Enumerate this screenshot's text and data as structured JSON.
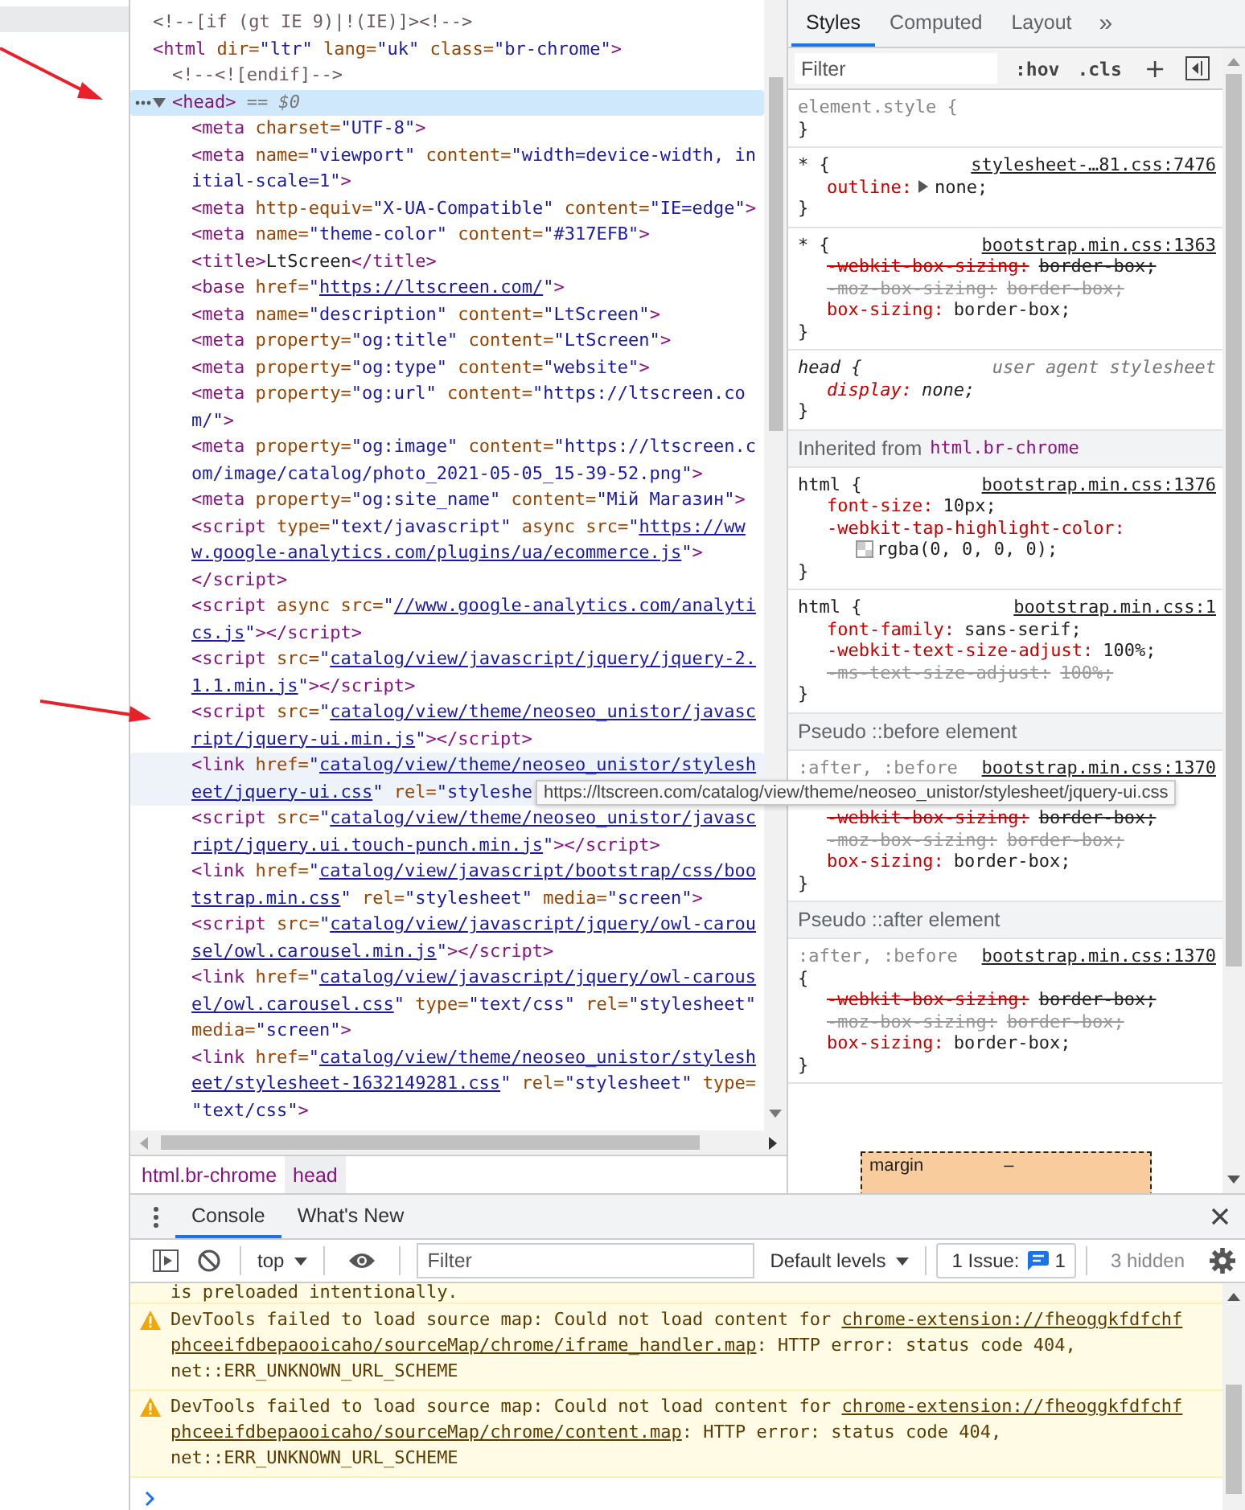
{
  "elements": {
    "nodes": [
      {
        "lines": [
          [
            {
              "kind": "comment",
              "text": "<!--[if (gt IE 9)|!(IE)]><!-->"
            }
          ]
        ],
        "selected": false,
        "hovered": false
      },
      {
        "lines": [
          [
            {
              "kind": "tag",
              "text": "<html"
            },
            {
              "kind": "attr",
              "text": " dir="
            },
            {
              "kind": "val",
              "text": "\"ltr\""
            },
            {
              "kind": "attr",
              "text": " lang="
            },
            {
              "kind": "val",
              "text": "\"uk\""
            },
            {
              "kind": "attr",
              "text": " class="
            },
            {
              "kind": "val",
              "text": "\"br-chrome\""
            },
            {
              "kind": "tag",
              "text": ">"
            }
          ]
        ],
        "selected": false,
        "hovered": false,
        "children": [
          {
            "lines": [
              [
                {
                  "kind": "comment",
                  "text": "<!--<![endif]-->"
                }
              ]
            ],
            "selected": false,
            "hovered": false
          },
          {
            "lines": [
              [
                {
                  "kind": "tag",
                  "text": "<head>"
                },
                {
                  "kind": "ref",
                  "text": " == $0"
                }
              ]
            ],
            "selected": true,
            "hovered": false,
            "expanded": true,
            "children": [
              {
                "lines": [
                  [
                    {
                      "kind": "tag",
                      "text": "<meta"
                    },
                    {
                      "kind": "attr",
                      "text": " charset="
                    },
                    {
                      "kind": "val",
                      "text": "\"UTF-8\""
                    },
                    {
                      "kind": "tag",
                      "text": ">"
                    }
                  ]
                ],
                "selected": false,
                "hovered": false
              },
              {
                "lines": [
                  [
                    {
                      "kind": "tag",
                      "text": "<meta"
                    },
                    {
                      "kind": "attr",
                      "text": " name="
                    },
                    {
                      "kind": "val",
                      "text": "\"viewport\""
                    },
                    {
                      "kind": "attr",
                      "text": " content="
                    },
                    {
                      "kind": "val",
                      "text": "\"width=device-width, in"
                    }
                  ],
                  [
                    {
                      "kind": "val",
                      "text": "itial-scale=1\""
                    },
                    {
                      "kind": "tag",
                      "text": ">"
                    }
                  ]
                ],
                "selected": false,
                "hovered": false
              },
              {
                "lines": [
                  [
                    {
                      "kind": "tag",
                      "text": "<meta"
                    },
                    {
                      "kind": "attr",
                      "text": " http-equiv="
                    },
                    {
                      "kind": "val",
                      "text": "\"X-UA-Compatible\""
                    },
                    {
                      "kind": "attr",
                      "text": " content="
                    },
                    {
                      "kind": "val",
                      "text": "\"IE=edge\""
                    },
                    {
                      "kind": "tag",
                      "text": ">"
                    }
                  ]
                ],
                "selected": false,
                "hovered": false
              },
              {
                "lines": [
                  [
                    {
                      "kind": "tag",
                      "text": "<meta"
                    },
                    {
                      "kind": "attr",
                      "text": " name="
                    },
                    {
                      "kind": "val",
                      "text": "\"theme-color\""
                    },
                    {
                      "kind": "attr",
                      "text": " content="
                    },
                    {
                      "kind": "val",
                      "text": "\"#317EFB\""
                    },
                    {
                      "kind": "tag",
                      "text": ">"
                    }
                  ]
                ],
                "selected": false,
                "hovered": false
              },
              {
                "lines": [
                  [
                    {
                      "kind": "tag",
                      "text": "<title>"
                    },
                    {
                      "kind": "text",
                      "text": "LtScreen"
                    },
                    {
                      "kind": "tag",
                      "text": "</title>"
                    }
                  ]
                ],
                "selected": false,
                "hovered": false
              },
              {
                "lines": [
                  [
                    {
                      "kind": "tag",
                      "text": "<base"
                    },
                    {
                      "kind": "attr",
                      "text": " href="
                    },
                    {
                      "kind": "val",
                      "text": "\""
                    },
                    {
                      "kind": "link",
                      "text": "https://ltscreen.com/"
                    },
                    {
                      "kind": "val",
                      "text": "\""
                    },
                    {
                      "kind": "tag",
                      "text": ">"
                    }
                  ]
                ],
                "selected": false,
                "hovered": false
              },
              {
                "lines": [
                  [
                    {
                      "kind": "tag",
                      "text": "<meta"
                    },
                    {
                      "kind": "attr",
                      "text": " name="
                    },
                    {
                      "kind": "val",
                      "text": "\"description\""
                    },
                    {
                      "kind": "attr",
                      "text": " content="
                    },
                    {
                      "kind": "val",
                      "text": "\"LtScreen\""
                    },
                    {
                      "kind": "tag",
                      "text": ">"
                    }
                  ]
                ],
                "selected": false,
                "hovered": false
              },
              {
                "lines": [
                  [
                    {
                      "kind": "tag",
                      "text": "<meta"
                    },
                    {
                      "kind": "attr",
                      "text": " property="
                    },
                    {
                      "kind": "val",
                      "text": "\"og:title\""
                    },
                    {
                      "kind": "attr",
                      "text": " content="
                    },
                    {
                      "kind": "val",
                      "text": "\"LtScreen\""
                    },
                    {
                      "kind": "tag",
                      "text": ">"
                    }
                  ]
                ],
                "selected": false,
                "hovered": false
              },
              {
                "lines": [
                  [
                    {
                      "kind": "tag",
                      "text": "<meta"
                    },
                    {
                      "kind": "attr",
                      "text": " property="
                    },
                    {
                      "kind": "val",
                      "text": "\"og:type\""
                    },
                    {
                      "kind": "attr",
                      "text": " content="
                    },
                    {
                      "kind": "val",
                      "text": "\"website\""
                    },
                    {
                      "kind": "tag",
                      "text": ">"
                    }
                  ]
                ],
                "selected": false,
                "hovered": false
              },
              {
                "lines": [
                  [
                    {
                      "kind": "tag",
                      "text": "<meta"
                    },
                    {
                      "kind": "attr",
                      "text": " property="
                    },
                    {
                      "kind": "val",
                      "text": "\"og:url\""
                    },
                    {
                      "kind": "attr",
                      "text": " content="
                    },
                    {
                      "kind": "val",
                      "text": "\"https://ltscreen.co"
                    }
                  ],
                  [
                    {
                      "kind": "val",
                      "text": "m/\""
                    },
                    {
                      "kind": "tag",
                      "text": ">"
                    }
                  ]
                ],
                "selected": false,
                "hovered": false
              },
              {
                "lines": [
                  [
                    {
                      "kind": "tag",
                      "text": "<meta"
                    },
                    {
                      "kind": "attr",
                      "text": " property="
                    },
                    {
                      "kind": "val",
                      "text": "\"og:image\""
                    },
                    {
                      "kind": "attr",
                      "text": " content="
                    },
                    {
                      "kind": "val",
                      "text": "\"https://ltscreen.c"
                    }
                  ],
                  [
                    {
                      "kind": "val",
                      "text": "om/image/catalog/photo_2021-05-05_15-39-52.png\""
                    },
                    {
                      "kind": "tag",
                      "text": ">"
                    }
                  ]
                ],
                "selected": false,
                "hovered": false
              },
              {
                "lines": [
                  [
                    {
                      "kind": "tag",
                      "text": "<meta"
                    },
                    {
                      "kind": "attr",
                      "text": " property="
                    },
                    {
                      "kind": "val",
                      "text": "\"og:site_name\""
                    },
                    {
                      "kind": "attr",
                      "text": " content="
                    },
                    {
                      "kind": "val",
                      "text": "\"Мій Магазин\""
                    },
                    {
                      "kind": "tag",
                      "text": ">"
                    }
                  ]
                ],
                "selected": false,
                "hovered": false
              },
              {
                "lines": [
                  [
                    {
                      "kind": "tag",
                      "text": "<script"
                    },
                    {
                      "kind": "attr",
                      "text": " type="
                    },
                    {
                      "kind": "val",
                      "text": "\"text/javascript\""
                    },
                    {
                      "kind": "attr",
                      "text": " async"
                    },
                    {
                      "kind": "attr",
                      "text": " src="
                    },
                    {
                      "kind": "val",
                      "text": "\""
                    },
                    {
                      "kind": "link",
                      "text": "https://ww"
                    }
                  ],
                  [
                    {
                      "kind": "link",
                      "text": "w.google-analytics.com/plugins/ua/ecommerce.js"
                    },
                    {
                      "kind": "val",
                      "text": "\""
                    },
                    {
                      "kind": "tag",
                      "text": ">"
                    }
                  ],
                  [
                    {
                      "kind": "tag",
                      "text": "</script>"
                    }
                  ]
                ],
                "selected": false,
                "hovered": false
              },
              {
                "lines": [
                  [
                    {
                      "kind": "tag",
                      "text": "<script"
                    },
                    {
                      "kind": "attr",
                      "text": " async"
                    },
                    {
                      "kind": "attr",
                      "text": " src="
                    },
                    {
                      "kind": "val",
                      "text": "\""
                    },
                    {
                      "kind": "link",
                      "text": "//www.google-analytics.com/analyti"
                    }
                  ],
                  [
                    {
                      "kind": "link",
                      "text": "cs.js"
                    },
                    {
                      "kind": "val",
                      "text": "\""
                    },
                    {
                      "kind": "tag",
                      "text": "></script>"
                    }
                  ]
                ],
                "selected": false,
                "hovered": false
              },
              {
                "lines": [
                  [
                    {
                      "kind": "tag",
                      "text": "<script"
                    },
                    {
                      "kind": "attr",
                      "text": " src="
                    },
                    {
                      "kind": "val",
                      "text": "\""
                    },
                    {
                      "kind": "link",
                      "text": "catalog/view/javascript/jquery/jquery-2."
                    }
                  ],
                  [
                    {
                      "kind": "link",
                      "text": "1.1.min.js"
                    },
                    {
                      "kind": "val",
                      "text": "\""
                    },
                    {
                      "kind": "tag",
                      "text": "></script>"
                    }
                  ]
                ],
                "selected": false,
                "hovered": false
              },
              {
                "lines": [
                  [
                    {
                      "kind": "tag",
                      "text": "<script"
                    },
                    {
                      "kind": "attr",
                      "text": " src="
                    },
                    {
                      "kind": "val",
                      "text": "\""
                    },
                    {
                      "kind": "link",
                      "text": "catalog/view/theme/neoseo_unistor/javasc"
                    }
                  ],
                  [
                    {
                      "kind": "link",
                      "text": "ript/jquery-ui.min.js"
                    },
                    {
                      "kind": "val",
                      "text": "\""
                    },
                    {
                      "kind": "tag",
                      "text": "></script>"
                    }
                  ]
                ],
                "selected": false,
                "hovered": false
              },
              {
                "lines": [
                  [
                    {
                      "kind": "tag",
                      "text": "<link"
                    },
                    {
                      "kind": "attr",
                      "text": " href="
                    },
                    {
                      "kind": "val",
                      "text": "\""
                    },
                    {
                      "kind": "link",
                      "text": "catalog/view/theme/neoseo_unistor/stylesh"
                    }
                  ],
                  [
                    {
                      "kind": "link",
                      "text": "eet/jquery-ui.css"
                    },
                    {
                      "kind": "val",
                      "text": "\""
                    },
                    {
                      "kind": "attr",
                      "text": " rel="
                    },
                    {
                      "kind": "val",
                      "text": "\"styleshe"
                    }
                  ]
                ],
                "selected": false,
                "hovered": true
              },
              {
                "lines": [
                  [
                    {
                      "kind": "tag",
                      "text": "<script"
                    },
                    {
                      "kind": "attr",
                      "text": " src="
                    },
                    {
                      "kind": "val",
                      "text": "\""
                    },
                    {
                      "kind": "link",
                      "text": "catalog/view/theme/neoseo_unistor/javasc"
                    }
                  ],
                  [
                    {
                      "kind": "link",
                      "text": "ript/jquery.ui.touch-punch.min.js"
                    },
                    {
                      "kind": "val",
                      "text": "\""
                    },
                    {
                      "kind": "tag",
                      "text": "></script>"
                    }
                  ]
                ],
                "selected": false,
                "hovered": false
              },
              {
                "lines": [
                  [
                    {
                      "kind": "tag",
                      "text": "<link"
                    },
                    {
                      "kind": "attr",
                      "text": " href="
                    },
                    {
                      "kind": "val",
                      "text": "\""
                    },
                    {
                      "kind": "link",
                      "text": "catalog/view/javascript/bootstrap/css/boo"
                    }
                  ],
                  [
                    {
                      "kind": "link",
                      "text": "tstrap.min.css"
                    },
                    {
                      "kind": "val",
                      "text": "\""
                    },
                    {
                      "kind": "attr",
                      "text": " rel="
                    },
                    {
                      "kind": "val",
                      "text": "\"stylesheet\""
                    },
                    {
                      "kind": "attr",
                      "text": " media="
                    },
                    {
                      "kind": "val",
                      "text": "\"screen\""
                    },
                    {
                      "kind": "tag",
                      "text": ">"
                    }
                  ]
                ],
                "selected": false,
                "hovered": false
              },
              {
                "lines": [
                  [
                    {
                      "kind": "tag",
                      "text": "<script"
                    },
                    {
                      "kind": "attr",
                      "text": " src="
                    },
                    {
                      "kind": "val",
                      "text": "\""
                    },
                    {
                      "kind": "link",
                      "text": "catalog/view/javascript/jquery/owl-carou"
                    }
                  ],
                  [
                    {
                      "kind": "link",
                      "text": "sel/owl.carousel.min.js"
                    },
                    {
                      "kind": "val",
                      "text": "\""
                    },
                    {
                      "kind": "tag",
                      "text": "></script>"
                    }
                  ]
                ],
                "selected": false,
                "hovered": false
              },
              {
                "lines": [
                  [
                    {
                      "kind": "tag",
                      "text": "<link"
                    },
                    {
                      "kind": "attr",
                      "text": " href="
                    },
                    {
                      "kind": "val",
                      "text": "\""
                    },
                    {
                      "kind": "link",
                      "text": "catalog/view/javascript/jquery/owl-carous"
                    }
                  ],
                  [
                    {
                      "kind": "link",
                      "text": "el/owl.carousel.css"
                    },
                    {
                      "kind": "val",
                      "text": "\""
                    },
                    {
                      "kind": "attr",
                      "text": " type="
                    },
                    {
                      "kind": "val",
                      "text": "\"text/css\""
                    },
                    {
                      "kind": "attr",
                      "text": " rel="
                    },
                    {
                      "kind": "val",
                      "text": "\"stylesheet\""
                    }
                  ],
                  [
                    {
                      "kind": "attr",
                      "text": "media="
                    },
                    {
                      "kind": "val",
                      "text": "\"screen\""
                    },
                    {
                      "kind": "tag",
                      "text": ">"
                    }
                  ]
                ],
                "selected": false,
                "hovered": false
              },
              {
                "lines": [
                  [
                    {
                      "kind": "tag",
                      "text": "<link"
                    },
                    {
                      "kind": "attr",
                      "text": " href="
                    },
                    {
                      "kind": "val",
                      "text": "\""
                    },
                    {
                      "kind": "link",
                      "text": "catalog/view/theme/neoseo_unistor/stylesh"
                    }
                  ],
                  [
                    {
                      "kind": "link",
                      "text": "eet/stylesheet-1632149281.css"
                    },
                    {
                      "kind": "val",
                      "text": "\""
                    },
                    {
                      "kind": "attr",
                      "text": " rel="
                    },
                    {
                      "kind": "val",
                      "text": "\"stylesheet\""
                    },
                    {
                      "kind": "attr",
                      "text": " type="
                    }
                  ],
                  [
                    {
                      "kind": "val",
                      "text": "\"text/css\""
                    },
                    {
                      "kind": "tag",
                      "text": ">"
                    }
                  ]
                ],
                "selected": false,
                "hovered": false
              }
            ]
          }
        ]
      }
    ]
  },
  "breadcrumbs": [
    {
      "text": "html.br-chrome",
      "selected": false
    },
    {
      "text": "head",
      "selected": true
    }
  ],
  "tooltip": "https://ltscreen.com/catalog/view/theme/neoseo_unistor/stylesheet/jquery-ui.css",
  "styles": {
    "tabs": [
      {
        "label": "Styles",
        "selected": true
      },
      {
        "label": "Computed",
        "selected": false
      },
      {
        "label": "Layout",
        "selected": false
      }
    ],
    "more": "»",
    "filter": {
      "placeholder": "Filter"
    },
    "buttons": [
      ":hov",
      ".cls",
      "+"
    ],
    "blocks": [
      {
        "kind": "rule",
        "selector": "element.style {",
        "dimmed": true,
        "user_agent": false,
        "close": "}"
      },
      {
        "kind": "rule",
        "selector": "* {",
        "source": "stylesheet-…81.css:7476",
        "dimmed": false,
        "user_agent": false,
        "props": [
          {
            "name": "outline:",
            "value": "none;",
            "overridden": false,
            "invalid": false,
            "expandable": true
          }
        ],
        "close": "}"
      },
      {
        "kind": "rule",
        "selector": "* {",
        "source": "bootstrap.min.css:1363",
        "dimmed": false,
        "user_agent": false,
        "props": [
          {
            "name": "-webkit-box-sizing:",
            "value": "border-box;",
            "overridden": true,
            "invalid": false
          },
          {
            "name": "-moz-box-sizing:",
            "value": "border-box;",
            "overridden": true,
            "invalid": true
          },
          {
            "name": "box-sizing:",
            "value": "border-box;",
            "overridden": false,
            "invalid": false
          }
        ],
        "close": "}"
      },
      {
        "kind": "rule",
        "selector": "head {",
        "source": "user agent stylesheet",
        "dimmed": false,
        "user_agent": true,
        "props": [
          {
            "name": "display:",
            "value": "none;",
            "overridden": false,
            "invalid": false
          }
        ],
        "close": "}"
      },
      {
        "kind": "header",
        "text": "Inherited from",
        "element": "html.br-chrome"
      },
      {
        "kind": "rule",
        "selector": "html {",
        "source": "bootstrap.min.css:1376",
        "dimmed": false,
        "user_agent": false,
        "props": [
          {
            "name": "font-size:",
            "value": "10px;",
            "overridden": false,
            "invalid": false
          },
          {
            "name": "-webkit-tap-highlight-color:",
            "value": "rgba(0, 0, 0, 0);",
            "overridden": false,
            "invalid": false,
            "swatch": true
          }
        ],
        "close": "}"
      },
      {
        "kind": "rule",
        "selector": "html {",
        "source": "bootstrap.min.css:1",
        "dimmed": false,
        "user_agent": false,
        "props": [
          {
            "name": "font-family:",
            "value": "sans-serif;",
            "overridden": false,
            "invalid": false
          },
          {
            "name": "-webkit-text-size-adjust:",
            "value": "100%;",
            "overridden": false,
            "invalid": false
          },
          {
            "name": "-ms-text-size-adjust:",
            "value": "100%;",
            "overridden": true,
            "invalid": true
          }
        ],
        "close": "}"
      },
      {
        "kind": "header",
        "text": "Pseudo ::before element"
      },
      {
        "kind": "rule",
        "selector": ":after, :before",
        "source": "bootstrap.min.css:1370",
        "dimmed": true,
        "user_agent": false,
        "brace_covered": true,
        "props": [
          {
            "name": "-webkit-box-sizing:",
            "value": "border-box;",
            "overridden": true,
            "invalid": false
          },
          {
            "name": "-moz-box-sizing:",
            "value": "border-box;",
            "overridden": true,
            "invalid": true
          },
          {
            "name": "box-sizing:",
            "value": "border-box;",
            "overridden": false,
            "invalid": false
          }
        ],
        "close": "}"
      },
      {
        "kind": "header",
        "text": "Pseudo ::after element"
      },
      {
        "kind": "rule",
        "selector": ":after, :before",
        "source": "bootstrap.min.css:1370",
        "dimmed": true,
        "user_agent": false,
        "brace": "{",
        "props": [
          {
            "name": "-webkit-box-sizing:",
            "value": "border-box;",
            "overridden": true,
            "invalid": false
          },
          {
            "name": "-moz-box-sizing:",
            "value": "border-box;",
            "overridden": true,
            "invalid": true
          },
          {
            "name": "box-sizing:",
            "value": "border-box;",
            "overridden": false,
            "invalid": false
          }
        ],
        "close": "}"
      }
    ],
    "box_model": {
      "label": "margin",
      "value": "–"
    }
  },
  "console": {
    "tabs": [
      {
        "label": "Console",
        "selected": true
      },
      {
        "label": "What's New",
        "selected": false
      }
    ],
    "context": "top",
    "filter": {
      "placeholder": "Filter"
    },
    "levels": "Default levels",
    "issues": {
      "label": "1 Issue:",
      "count": "1"
    },
    "hidden": "3 hidden",
    "messages": [
      {
        "kind": "warning",
        "continued": true,
        "lines": [
          [
            {
              "kind": "text",
              "text": "is preloaded intentionally."
            }
          ]
        ]
      },
      {
        "kind": "warning",
        "continued": false,
        "lines": [
          [
            {
              "kind": "text",
              "text": "DevTools failed to load source map: Could not load content for "
            },
            {
              "kind": "link",
              "text": "chrome-extension://fheoggkfdfchf"
            }
          ],
          [
            {
              "kind": "link",
              "text": "phceeifdbepaooicaho/sourceMap/chrome/iframe_handler.map"
            },
            {
              "kind": "text",
              "text": ": HTTP error: status code 404,"
            }
          ],
          [
            {
              "kind": "text",
              "text": "net::ERR_UNKNOWN_URL_SCHEME"
            }
          ]
        ]
      },
      {
        "kind": "warning",
        "continued": false,
        "lines": [
          [
            {
              "kind": "text",
              "text": "DevTools failed to load source map: Could not load content for "
            },
            {
              "kind": "link",
              "text": "chrome-extension://fheoggkfdfchf"
            }
          ],
          [
            {
              "kind": "link",
              "text": "phceeifdbepaooicaho/sourceMap/chrome/content.map"
            },
            {
              "kind": "text",
              "text": ": HTTP error: status code 404,"
            }
          ],
          [
            {
              "kind": "text",
              "text": "net::ERR_UNKNOWN_URL_SCHEME"
            }
          ]
        ]
      }
    ]
  }
}
